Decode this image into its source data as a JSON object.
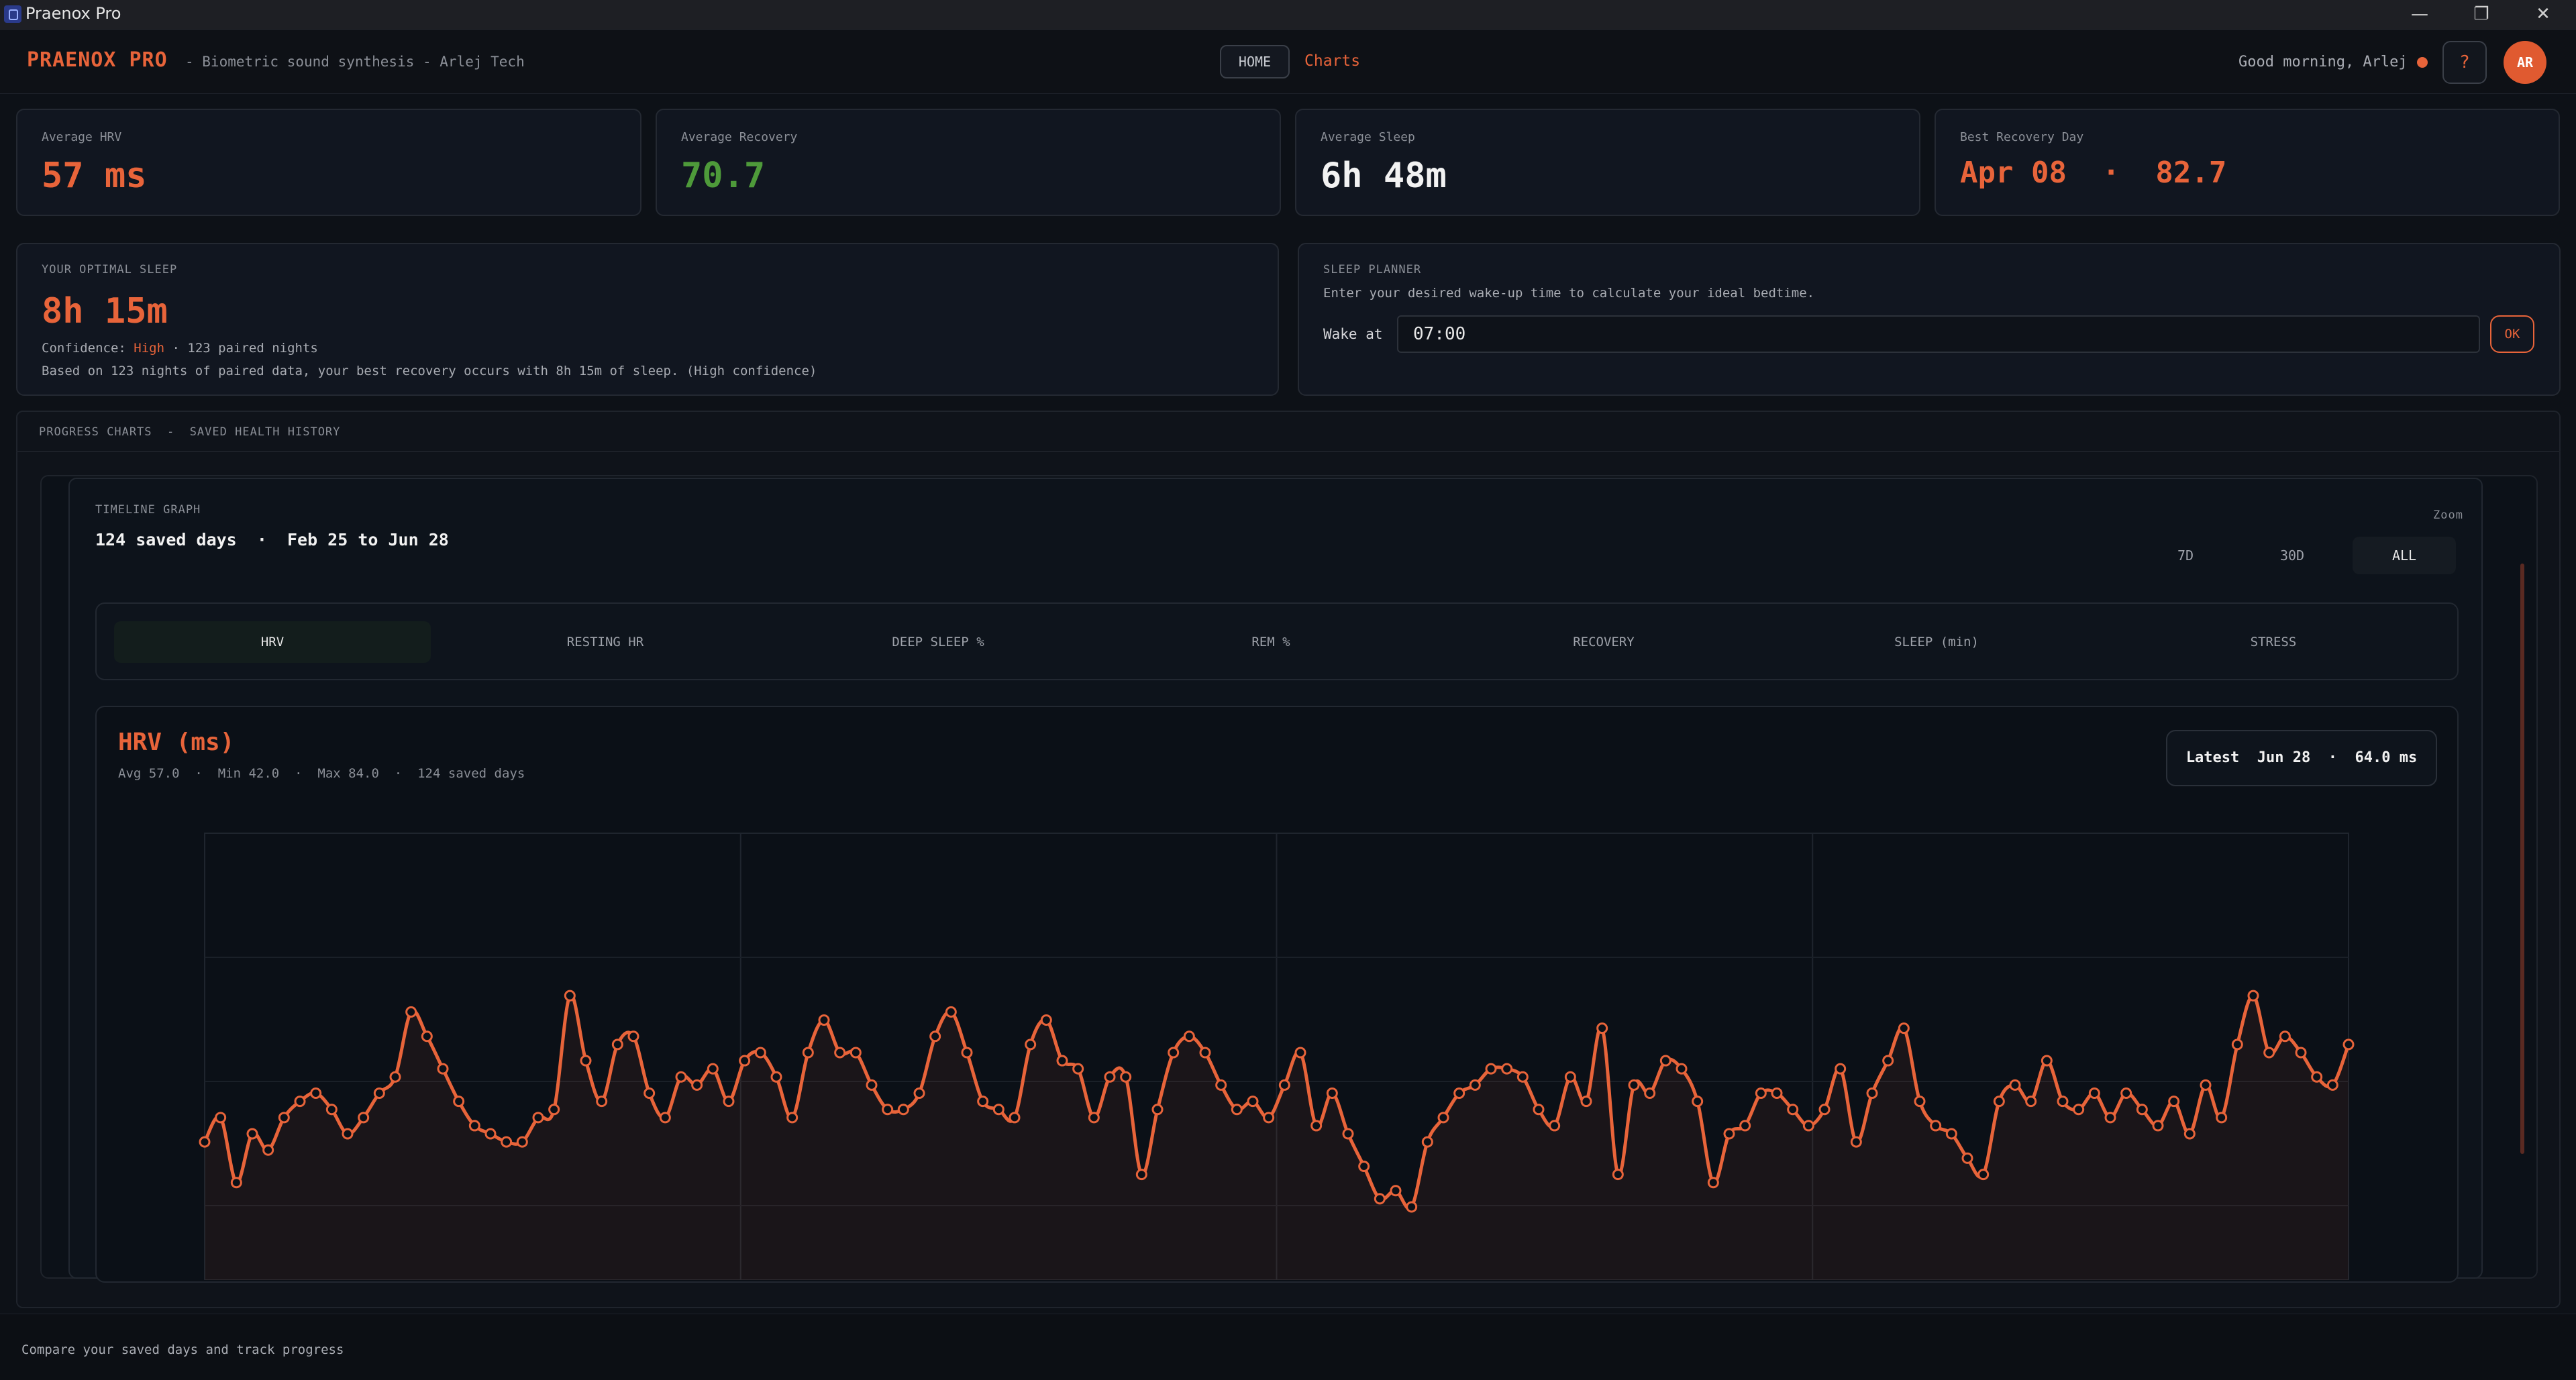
{
  "window": {
    "title": "Praenox Pro",
    "minimize": "—",
    "restore": "❐",
    "close": "✕"
  },
  "header": {
    "brand": "PRAENOX PRO",
    "subtitle": "- Biometric sound synthesis - Arlej Tech",
    "nav_home": "HOME",
    "nav_charts": "Charts",
    "greeting": "Good morning, Arlej",
    "help": "?",
    "avatar": "AR"
  },
  "stats": [
    {
      "label": "Average HRV",
      "value": "57 ms",
      "color": "#e8643a"
    },
    {
      "label": "Average Recovery",
      "value": "70.7",
      "color": "#4e9a3a"
    },
    {
      "label": "Average Sleep",
      "value": "6h 48m",
      "color": "#f2f2f2"
    },
    {
      "label": "Best Recovery Day",
      "value": "Apr 08  ·  82.7",
      "color": "#e8643a"
    }
  ],
  "optimal_sleep": {
    "title": "YOUR OPTIMAL SLEEP",
    "value": "8h 15m",
    "confidence_label": "Confidence:",
    "confidence_value": "High",
    "confidence_rest": "· 123 paired nights",
    "note": "Based on 123 nights of paired data, your best recovery occurs with 8h 15m of sleep. (High confidence)"
  },
  "planner": {
    "title": "SLEEP PLANNER",
    "desc": "Enter your desired wake-up time to calculate your ideal bedtime.",
    "wake_label": "Wake at",
    "wake_value": "07:00",
    "ok": "OK"
  },
  "progress": {
    "label": "PROGRESS CHARTS  -  SAVED HEALTH HISTORY"
  },
  "timeline": {
    "title": "TIMELINE GRAPH",
    "summary": "124 saved days  ·  Feb 25 to Jun 28",
    "zoom_label": "Zoom",
    "zoom_options": [
      "7D",
      "30D",
      "ALL"
    ],
    "zoom_selected": "ALL"
  },
  "metric_tabs": [
    "HRV",
    "RESTING HR",
    "DEEP SLEEP %",
    "REM %",
    "RECOVERY",
    "SLEEP (min)",
    "STRESS"
  ],
  "metric_selected": "HRV",
  "chart_panel": {
    "title": "HRV (ms)",
    "stats": "Avg 57.0  ·  Min 42.0  ·  Max 84.0  ·  124 saved days",
    "latest": "Latest  Jun 28  ·  64.0 ms"
  },
  "chart_data": {
    "type": "line",
    "series": [
      {
        "values": [
          52,
          55,
          47,
          53,
          51,
          55,
          57,
          58,
          56,
          53,
          55,
          58,
          60,
          68,
          65,
          61,
          57,
          54,
          53,
          52,
          52,
          55,
          56,
          70,
          62,
          57,
          64,
          65,
          58,
          55,
          60,
          59,
          61,
          57,
          62,
          63,
          60,
          55,
          63,
          67,
          63,
          63,
          59,
          56,
          56,
          58,
          65,
          68,
          63,
          57,
          56,
          55,
          64,
          67,
          62,
          61,
          55,
          60,
          60,
          48,
          56,
          63,
          65,
          63,
          59,
          56,
          57,
          55,
          59,
          63,
          54,
          58,
          53,
          49,
          45,
          46,
          44,
          52,
          55,
          58,
          59,
          61,
          61,
          60,
          56,
          54,
          60,
          57,
          66,
          48,
          59,
          58,
          62,
          61,
          57,
          47,
          53,
          54,
          58,
          58,
          56,
          54,
          56,
          61,
          52,
          58,
          62,
          66,
          57,
          54,
          53,
          50,
          48,
          57,
          59,
          57,
          62,
          57,
          56,
          58,
          55,
          58,
          56,
          54,
          57,
          53,
          59,
          55,
          64,
          70,
          63,
          65,
          63,
          60,
          59,
          64
        ]
      }
    ],
    "ylim": [
      35,
      90
    ],
    "grid": true,
    "line_color": "#e8643a"
  },
  "footer": {
    "text": "Compare your saved days and track progress"
  }
}
